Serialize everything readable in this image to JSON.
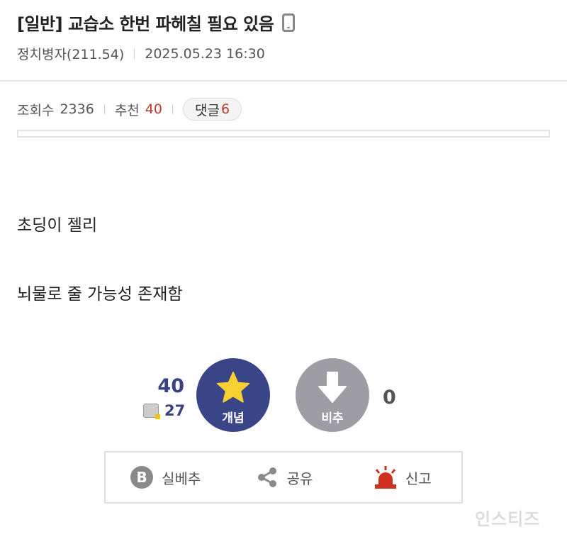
{
  "post": {
    "title": "[일반] 교습소 한번 파헤칠 필요 있음",
    "author": "정치병자(211.54)",
    "datetime": "2025.05.23 16:30",
    "device_icon": "mobile-phone-icon"
  },
  "stats": {
    "views_label": "조회수",
    "views": "2336",
    "recommend_label": "추천",
    "recommend": "40",
    "comments_label": "댓글",
    "comments": "6"
  },
  "content": {
    "lines": [
      "초딩이 젤리",
      "뇌물로 줄 가능성 존재함"
    ]
  },
  "vote": {
    "up_count": "40",
    "up_sub_count": "27",
    "up_label": "개념",
    "down_label": "비추",
    "down_count": "0",
    "up_color": "#3a4588",
    "down_color": "#9d9da3",
    "star_color": "#f7d031"
  },
  "actions": {
    "realbest_label": "실베추",
    "realbest_icon_letter": "B",
    "share_label": "공유",
    "report_label": "신고",
    "report_color": "#d0301f"
  },
  "watermark": "인스티즈"
}
